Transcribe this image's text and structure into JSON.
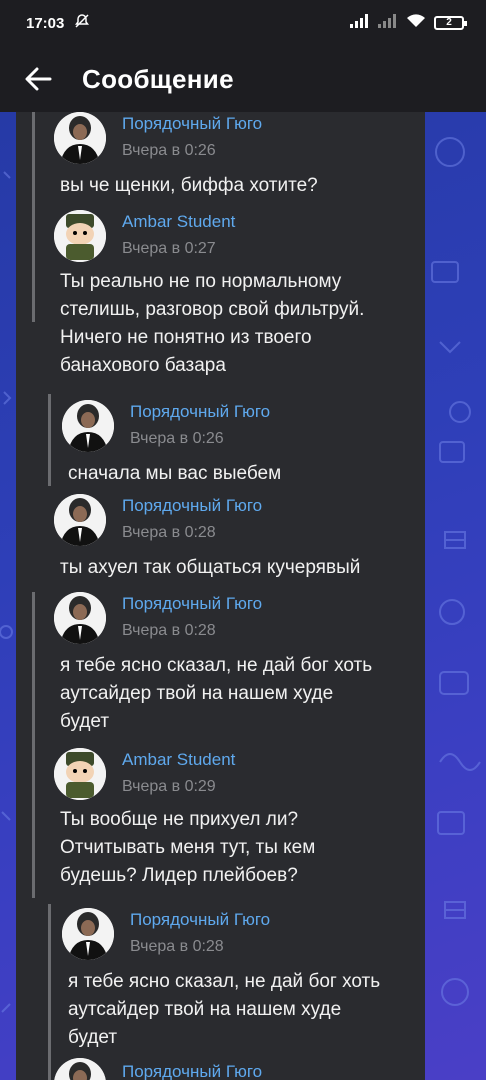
{
  "status": {
    "time": "17:03",
    "battery": "2"
  },
  "header": {
    "title": "Сообщение"
  },
  "messages": [
    {
      "author": "Порядочный Гюго",
      "time": "Вчера в 0:26",
      "text": "вы че щенки, биффа хотите?",
      "avatar": "hugo"
    },
    {
      "author": "Ambar Student",
      "time": "Вчера в 0:27",
      "text": "Ты реально не по нормальному стелишь, разговор свой фильтруй. Ничего не понятно из твоего банахового базара",
      "avatar": "ambar"
    },
    {
      "author": "Порядочный Гюго",
      "time": "Вчера в 0:26",
      "text": "сначала мы вас выебем",
      "avatar": "hugo"
    },
    {
      "author": "Порядочный Гюго",
      "time": "Вчера в 0:28",
      "text": "ты ахуел так общаться кучерявый",
      "avatar": "hugo"
    },
    {
      "author": "Порядочный Гюго",
      "time": "Вчера в 0:28",
      "text": "я тебе ясно сказал, не дай бог хоть аутсайдер твой на нашем худе будет",
      "avatar": "hugo"
    },
    {
      "author": "Ambar Student",
      "time": "Вчера в 0:29",
      "text": "Ты вообще не прихуел ли? Отчитывать меня тут, ты кем будешь? Лидер плейбоев?",
      "avatar": "ambar"
    },
    {
      "author": "Порядочный Гюго",
      "time": "Вчера в 0:28",
      "text": "я тебе ясно сказал, не дай бог хоть аутсайдер твой на нашем худе будет",
      "avatar": "hugo"
    },
    {
      "author": "Порядочный Гюго",
      "time": "",
      "text": "",
      "avatar": "hugo"
    }
  ]
}
